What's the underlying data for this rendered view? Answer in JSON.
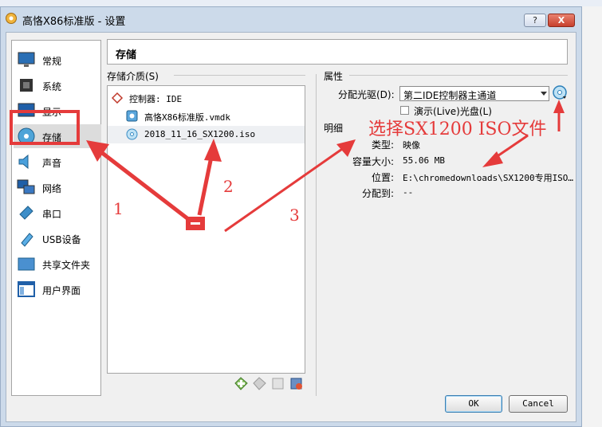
{
  "window": {
    "title": "高恪X86标准版 - 设置",
    "help_label": "?",
    "close_label": "X"
  },
  "sidebar": {
    "items": [
      {
        "label": "常规",
        "icon": "monitor-icon"
      },
      {
        "label": "系统",
        "icon": "chip-icon"
      },
      {
        "label": "显示",
        "icon": "display-icon"
      },
      {
        "label": "存储",
        "icon": "storage-disc-icon"
      },
      {
        "label": "声音",
        "icon": "speaker-icon"
      },
      {
        "label": "网络",
        "icon": "network-icon"
      },
      {
        "label": "串口",
        "icon": "serial-port-icon"
      },
      {
        "label": "USB设备",
        "icon": "usb-icon"
      },
      {
        "label": "共享文件夹",
        "icon": "folder-icon"
      },
      {
        "label": "用户界面",
        "icon": "ui-window-icon"
      }
    ],
    "active_index": 3
  },
  "header": {
    "title": "存储"
  },
  "storage_media": {
    "label": "存储介质(S)",
    "controller": "控制器: IDE",
    "items": [
      {
        "name": "高恪X86标准版.vmdk",
        "icon": "hard-disk-icon"
      },
      {
        "name": "2018_11_16_SX1200.iso",
        "icon": "optical-disc-icon"
      }
    ]
  },
  "attributes": {
    "label": "属性",
    "drive_label": "分配光驱(D):",
    "drive_value": "第二IDE控制器主通道",
    "live_cd_label": "演示(Live)光盘(L)"
  },
  "details": {
    "label": "明细",
    "rows": [
      {
        "key": "类型:",
        "value": "映像"
      },
      {
        "key": "容量大小:",
        "value": "55.06 MB"
      },
      {
        "key": "位置:",
        "value": "E:\\chromedownloads\\SX1200专用ISO…"
      },
      {
        "key": "分配到:",
        "value": "--"
      }
    ]
  },
  "buttons": {
    "ok": "OK",
    "cancel": "Cancel"
  },
  "annotations": {
    "callout": "选择SX1200 ISO文件",
    "numbers": [
      "1",
      "2",
      "3"
    ],
    "color": "#e53b3b"
  }
}
